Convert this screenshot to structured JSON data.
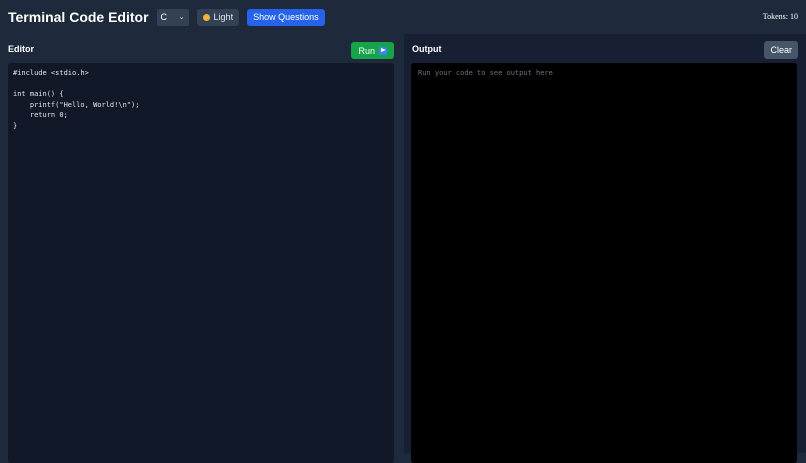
{
  "header": {
    "title": "Terminal Code Editor",
    "language": "C",
    "theme_label": "Light",
    "questions_label": "Show Questions",
    "tokens": "Tokens: 10"
  },
  "editor": {
    "label": "Editor",
    "run_label": "Run",
    "code": "#include <stdio.h>\n\nint main() {\n    printf(\"Hello, World!\\n\");\n    return 0;\n}"
  },
  "output": {
    "label": "Output",
    "clear_label": "Clear",
    "placeholder": "Run your code to see output here"
  }
}
